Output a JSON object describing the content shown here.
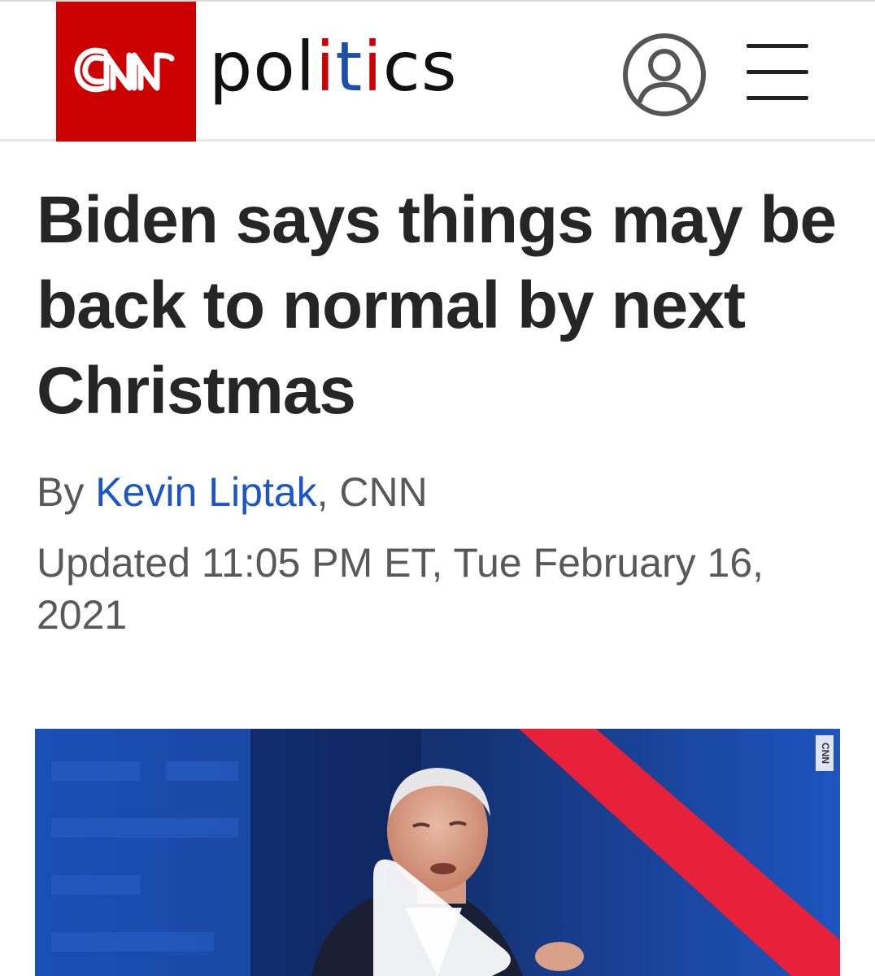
{
  "header": {
    "logo_text": "CNN",
    "section": {
      "part1": "pol",
      "part2": "i",
      "part3": "t",
      "part4": "i",
      "part5": "cs"
    },
    "user_icon": "user-circle-icon",
    "menu_icon": "hamburger-menu-icon"
  },
  "article": {
    "headline": "Biden says things may be back to normal by next Christmas",
    "byline_prefix": "By ",
    "author": "Kevin Liptak",
    "byline_suffix": ", CNN",
    "updated": "Updated 11:05 PM ET, Tue February 16, 2021"
  },
  "video": {
    "watermark": "CNN",
    "play_icon": "play-icon"
  },
  "colors": {
    "brand_red": "#cc0000",
    "link_blue": "#1a56c9",
    "politics_blue": "#1d4fa8",
    "headline": "#262626",
    "meta_gray": "#595959"
  }
}
